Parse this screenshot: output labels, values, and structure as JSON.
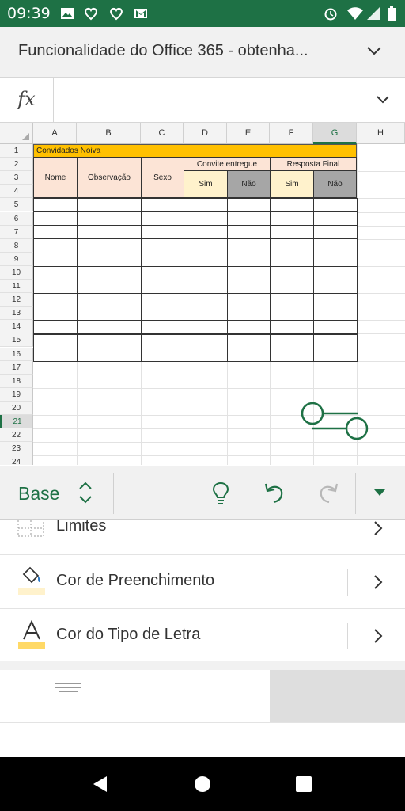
{
  "status_bar": {
    "time": "09:39",
    "left_icons": [
      "image-icon",
      "heart-notification-icon",
      "heart-notification-icon",
      "gmail-icon"
    ],
    "right_icons": [
      "alarm-icon",
      "wifi-icon",
      "signal-icon",
      "battery-icon"
    ]
  },
  "title_bar": {
    "title": "Funcionalidade do Office 365 - obtenha..."
  },
  "formula_bar": {
    "fx_label": "fx",
    "value": ""
  },
  "sheet": {
    "columns": [
      "A",
      "B",
      "C",
      "D",
      "E",
      "F",
      "G",
      "H"
    ],
    "active_column": "G",
    "rows": [
      "1",
      "2",
      "3",
      "4",
      "5",
      "6",
      "7",
      "8",
      "9",
      "10",
      "11",
      "12",
      "13",
      "14",
      "15",
      "16",
      "17",
      "18",
      "19",
      "20",
      "21",
      "22",
      "23",
      "24"
    ],
    "active_row": "21",
    "title_cell": "Convidados Noiva",
    "headers": {
      "nome": "Nome",
      "observacao": "Observação",
      "sexo": "Sexo",
      "convite": "Convite entregue",
      "resposta": "Resposta Final",
      "sim1": "Sim",
      "nao1": "Não",
      "sim2": "Sim",
      "nao2": "Não"
    },
    "colors": {
      "title_fill": "#ffc000",
      "header_peach": "#fce4d6",
      "header_yellow": "#fff2cc",
      "header_gray": "#a6a6a6",
      "accent": "#1e7145"
    }
  },
  "toolbar": {
    "tab_label": "Base",
    "icons": [
      "updown-icon",
      "lightbulb-icon",
      "undo-icon",
      "redo-icon",
      "collapse-triangle-icon"
    ]
  },
  "menu": {
    "items": [
      {
        "label": "Limites",
        "icon": "borders-icon"
      },
      {
        "label": "Cor de Preenchimento",
        "icon": "fill-bucket-icon"
      },
      {
        "label": "Cor do Tipo de Letra",
        "icon": "font-color-icon"
      }
    ]
  },
  "alignment": {
    "buttons": [
      "align-top-icon",
      "align-middle-icon",
      "align-bottom-icon",
      "align-left-icon",
      "align-center-icon",
      "align-right-icon"
    ],
    "selected": "align-bottom-icon"
  },
  "nav_bar": {
    "icons": [
      "back-icon",
      "home-icon",
      "recents-icon"
    ]
  }
}
